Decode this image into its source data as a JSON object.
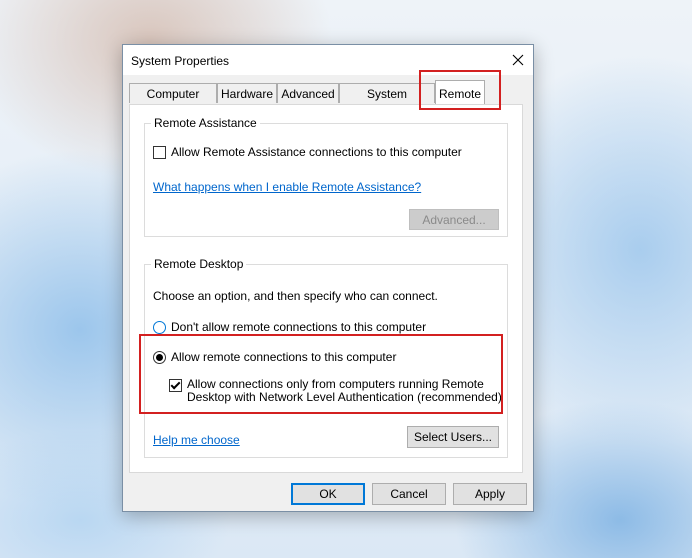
{
  "window": {
    "title": "System Properties"
  },
  "tabs": [
    {
      "label": "Computer Name"
    },
    {
      "label": "Hardware"
    },
    {
      "label": "Advanced"
    },
    {
      "label": "System Protection"
    },
    {
      "label": "Remote",
      "active": true
    }
  ],
  "remote_assistance": {
    "title": "Remote Assistance",
    "allow_label": "Allow Remote Assistance connections to this computer",
    "allow_checked": false,
    "help_link": "What happens when I enable Remote Assistance?",
    "advanced_button": "Advanced..."
  },
  "remote_desktop": {
    "title": "Remote Desktop",
    "instruction": "Choose an option, and then specify who can connect.",
    "option_dont_allow": "Don't allow remote connections to this computer",
    "option_allow": "Allow remote connections to this computer",
    "selected_option": "allow",
    "nla_label_line1": "Allow connections only from computers running Remote",
    "nla_label_line2": "Desktop with Network Level Authentication (recommended)",
    "nla_checked": true,
    "help_link": "Help me choose",
    "select_users_button": "Select Users..."
  },
  "footer": {
    "ok": "OK",
    "cancel": "Cancel",
    "apply": "Apply"
  },
  "colors": {
    "highlight": "#d32020",
    "link": "#0066cc",
    "accent": "#0078d7"
  }
}
